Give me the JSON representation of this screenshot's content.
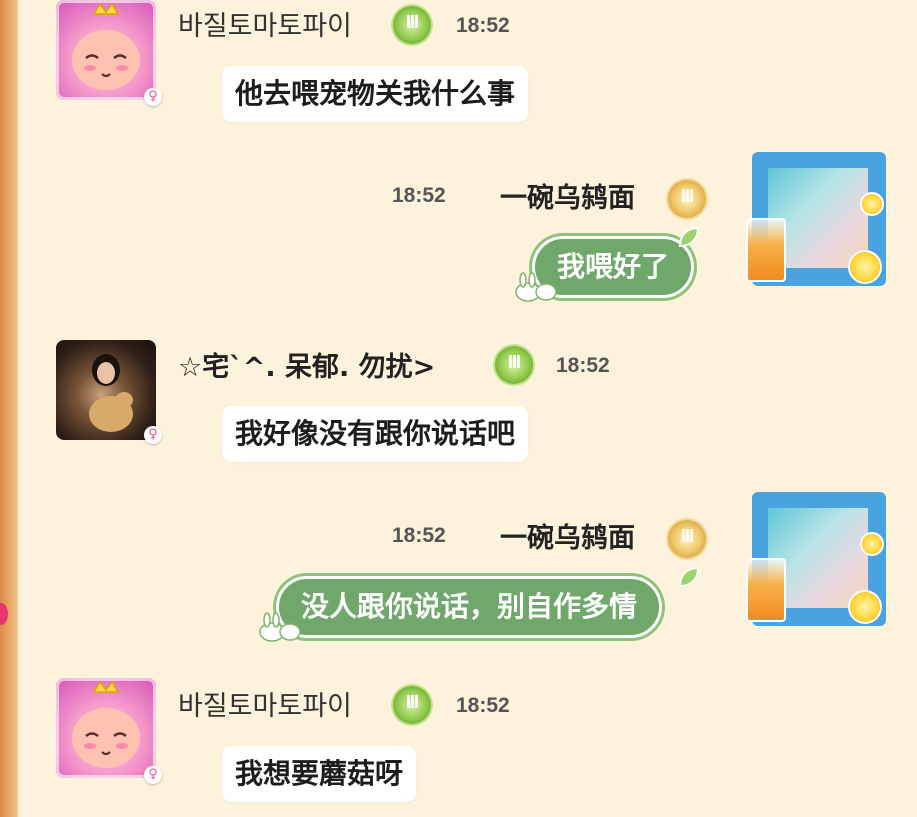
{
  "messages": [
    {
      "side": "left",
      "avatar": "pink-mushroom-avatar",
      "gender_icon": "♀",
      "name": "바질토마토파이",
      "badge": "III",
      "time": "18:52",
      "text": "他去喂宠物关我什么事"
    },
    {
      "side": "right",
      "avatar": "ocean-frame-avatar",
      "name": "一碗乌鸫面",
      "badge": "III",
      "time": "18:52",
      "text": "我喂好了"
    },
    {
      "side": "left",
      "avatar": "photo-avatar",
      "gender_icon": "♀",
      "name": "☆宅`^. 呆郁. 勿扰>",
      "badge": "III",
      "time": "18:52",
      "text": "我好像没有跟你说话吧"
    },
    {
      "side": "right",
      "avatar": "ocean-frame-avatar",
      "name": "一碗乌鸫面",
      "badge": "III",
      "time": "18:52",
      "text": "没人跟你说话，别自作多情"
    },
    {
      "side": "left",
      "avatar": "pink-mushroom-avatar",
      "gender_icon": "♀",
      "name": "바질토마토파이",
      "badge": "III",
      "time": "18:52",
      "text": "我想要蘑菇呀"
    }
  ],
  "colors": {
    "background": "#fdf3dc",
    "green_bubble": "#6fa86a",
    "gender_pink": "#e25892"
  }
}
